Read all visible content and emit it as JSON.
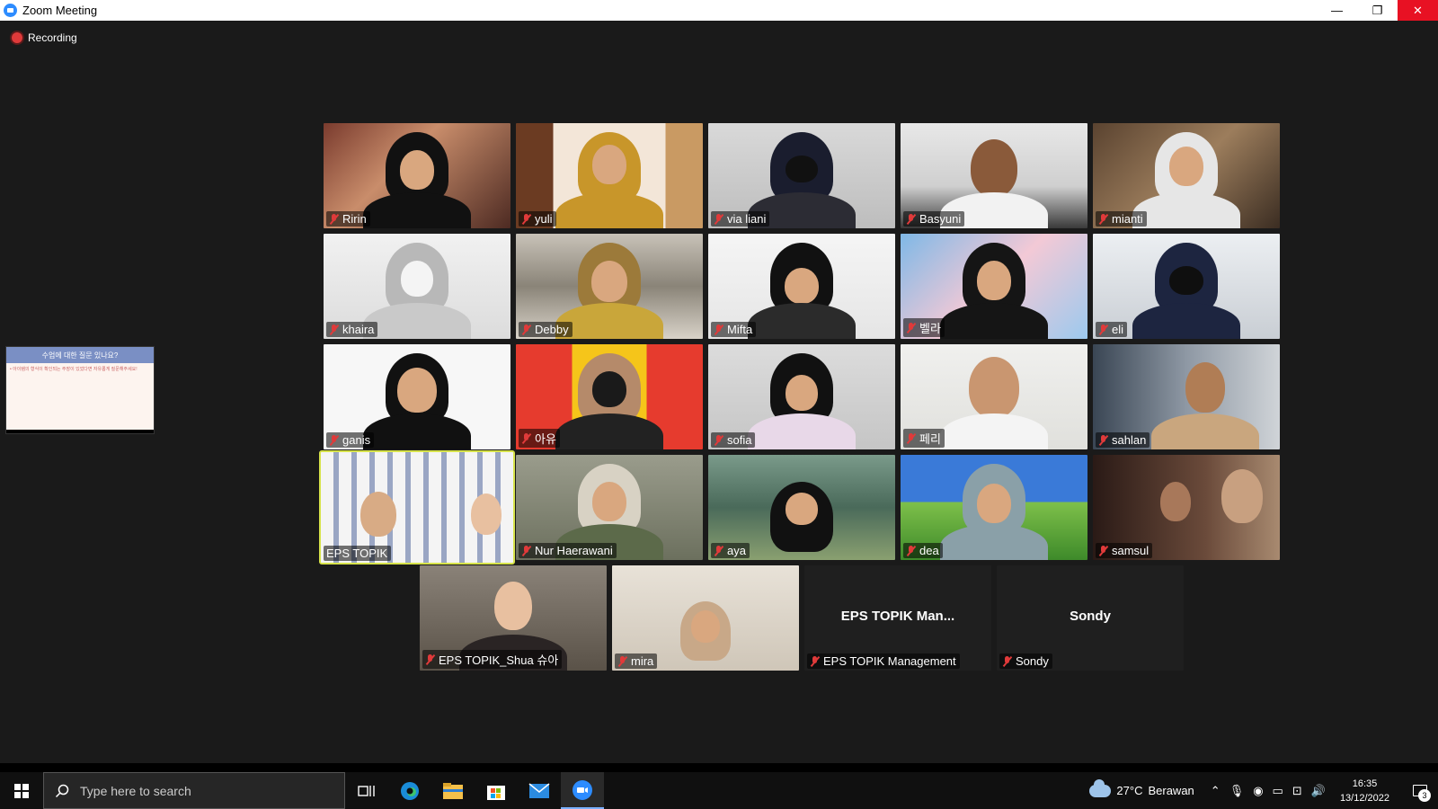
{
  "window": {
    "title": "Zoom Meeting",
    "min": "—",
    "restore": "❐",
    "close": "✕"
  },
  "recording": {
    "label": "Recording"
  },
  "share_thumb": {
    "heading": "수업에 대한 질문 있나요?",
    "subtext": "• 아이템의 형식이 확인되는 주장이 있었다면 자유롭게 질문해주세요!"
  },
  "participants": [
    {
      "name": "Ririn",
      "muted": true
    },
    {
      "name": "yuli",
      "muted": true
    },
    {
      "name": "via liani",
      "muted": true
    },
    {
      "name": "Basyuni",
      "muted": true
    },
    {
      "name": "mianti",
      "muted": true
    },
    {
      "name": "khaira",
      "muted": true
    },
    {
      "name": "Debby",
      "muted": true
    },
    {
      "name": "Mifta",
      "muted": true
    },
    {
      "name": "벨라",
      "muted": true
    },
    {
      "name": "eli",
      "muted": true
    },
    {
      "name": "ganis",
      "muted": true
    },
    {
      "name": "아유",
      "muted": true
    },
    {
      "name": "sofia",
      "muted": true
    },
    {
      "name": "페리",
      "muted": true
    },
    {
      "name": "sahlan",
      "muted": true
    },
    {
      "name": "EPS TOPIK",
      "muted": false
    },
    {
      "name": "Nur Haerawani",
      "muted": true
    },
    {
      "name": "aya",
      "muted": true
    },
    {
      "name": "dea",
      "muted": true
    },
    {
      "name": "samsul",
      "muted": true
    },
    {
      "name": "EPS TOPIK_Shua 슈아",
      "muted": true
    },
    {
      "name": "mira",
      "muted": true
    },
    {
      "name": "EPS TOPIK Management",
      "muted": true,
      "display": "EPS TOPIK Man..."
    },
    {
      "name": "Sondy",
      "muted": true,
      "display": "Sondy"
    }
  ],
  "taskbar": {
    "search_placeholder": "Type here to search",
    "weather_temp": "27°C",
    "weather_text": "Berawan",
    "time": "16:35",
    "date": "13/12/2022",
    "notif_count": "3"
  },
  "colors": {
    "speaker_highlight": "#d7e34b",
    "mute_red": "#e03a3a",
    "close_red": "#e81123",
    "zoom_blue": "#2d8cff"
  }
}
